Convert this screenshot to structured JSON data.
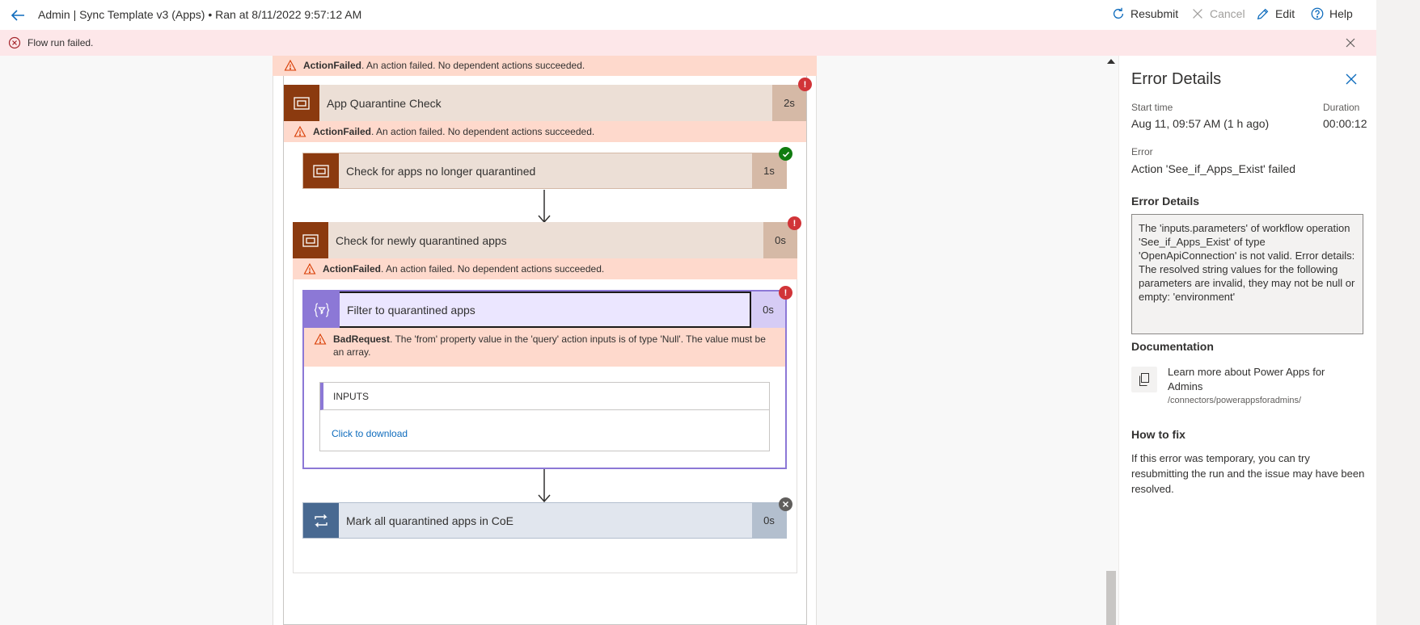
{
  "header": {
    "title": "Admin | Sync Template v3 (Apps) • Ran at 8/11/2022 9:57:12 AM",
    "resubmit": "Resubmit",
    "cancel": "Cancel",
    "edit": "Edit",
    "help": "Help"
  },
  "banner": {
    "message": "Flow run failed."
  },
  "flow": {
    "top_warning": {
      "code": "ActionFailed",
      "text": ". An action failed. No dependent actions succeeded."
    },
    "app_quarantine": {
      "label": "App Quarantine Check",
      "duration": "2s",
      "status": "failed",
      "warning_code": "ActionFailed",
      "warning_text": ". An action failed. No dependent actions succeeded."
    },
    "check_no_longer": {
      "label": "Check for apps no longer quarantined",
      "duration": "1s",
      "status": "succeeded"
    },
    "check_newly": {
      "label": "Check for newly quarantined apps",
      "duration": "0s",
      "status": "failed",
      "warning_code": "ActionFailed",
      "warning_text": ". An action failed. No dependent actions succeeded."
    },
    "filter": {
      "label": "Filter to quarantined apps",
      "duration": "0s",
      "status": "failed",
      "error_code": "BadRequest",
      "error_text": ". The 'from' property value in the 'query' action inputs is of type 'Null'. The value must be an array.",
      "inputs_header": "INPUTS",
      "inputs_link": "Click to download"
    },
    "mark_all": {
      "label": "Mark all quarantined apps in CoE",
      "duration": "0s",
      "status": "skipped"
    }
  },
  "panel": {
    "title": "Error Details",
    "start_time_label": "Start time",
    "start_time": "Aug 11, 09:57 AM (1 h ago)",
    "duration_label": "Duration",
    "duration": "00:00:12",
    "error_label": "Error",
    "error": "Action 'See_if_Apps_Exist' failed",
    "error_details_heading": "Error Details",
    "error_details": "The 'inputs.parameters' of workflow operation 'See_if_Apps_Exist' of type 'OpenApiConnection' is not valid. Error details: The resolved string values for the following parameters are invalid, they may not be null or empty: 'environment'",
    "documentation_heading": "Documentation",
    "doc_link": "Learn more about Power Apps for Admins",
    "doc_path": "/connectors/powerappsforadmins/",
    "how_to_fix_heading": "How to fix",
    "how_to_fix": "If this error was temporary, you can try resubmitting the run and the issue may have been resolved."
  },
  "colors": {
    "control_brown": "#8b3a0f",
    "control_header_bg": "#ecdfd6",
    "filter_purple": "#8c78d6",
    "filter_bg": "#ebe6ff",
    "loop_blue": "#486991",
    "loop_bg": "#e1e6ee",
    "error_red": "#d13438",
    "success_green": "#107c10",
    "warning_bg": "#fed9cc"
  }
}
